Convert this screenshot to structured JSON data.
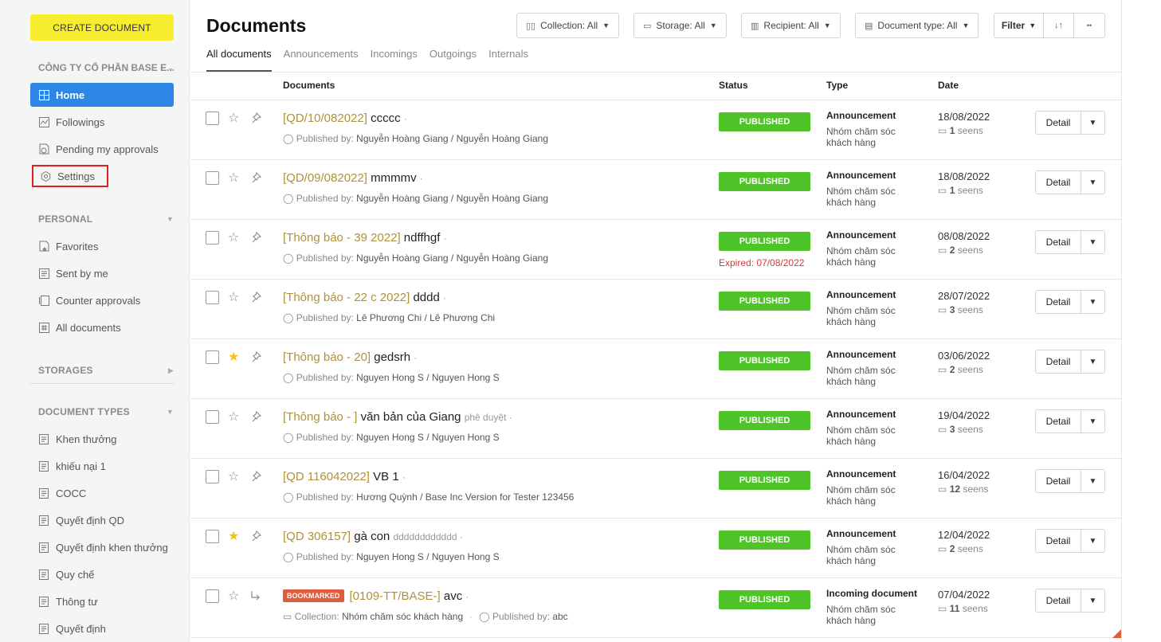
{
  "sidebar": {
    "create_label": "CREATE DOCUMENT",
    "company": "CÔNG TY CỔ PHẦN BASE E...",
    "main_items": [
      {
        "label": "Home",
        "icon": "grid-icon"
      },
      {
        "label": "Followings",
        "icon": "chart-icon"
      },
      {
        "label": "Pending my approvals",
        "icon": "clock-doc-icon"
      },
      {
        "label": "Settings",
        "icon": "gear-icon"
      }
    ],
    "personal_title": "PERSONAL",
    "personal_items": [
      {
        "label": "Favorites",
        "icon": "star-doc-icon"
      },
      {
        "label": "Sent by me",
        "icon": "doc-icon"
      },
      {
        "label": "Counter approvals",
        "icon": "copy-icon"
      },
      {
        "label": "All documents",
        "icon": "hash-icon"
      }
    ],
    "storages_title": "STORAGES",
    "doctypes_title": "DOCUMENT TYPES",
    "doctype_items": [
      "Khen thưởng",
      "khiếu nại 1",
      "COCC",
      "Quyết định QD",
      "Quyết định khen thưởng",
      "Quy chế",
      "Thông tư",
      "Quyết định"
    ]
  },
  "header": {
    "title": "Documents",
    "filters": [
      {
        "label": "Collection: All",
        "icon": "book-icon"
      },
      {
        "label": "Storage: All",
        "icon": "box-icon"
      },
      {
        "label": "Recipient: All",
        "icon": "columns-icon"
      },
      {
        "label": "Document type: All",
        "icon": "file-icon"
      }
    ],
    "filter_label": "Filter",
    "sort_icon": "↓↑",
    "more_icon": "••"
  },
  "tabs": [
    "All documents",
    "Announcements",
    "Incomings",
    "Outgoings",
    "Internals"
  ],
  "columns": {
    "documents": "Documents",
    "status": "Status",
    "type": "Type",
    "date": "Date"
  },
  "rows": [
    {
      "code": "[QD/10/082022]",
      "name": "ccccc",
      "sub": "",
      "meta_label": "Published by:",
      "meta_value": "Nguyễn Hoàng Giang / Nguyễn Hoàng Giang",
      "status": "PUBLISHED",
      "expired": "",
      "type": "Announcement",
      "recipient": "Nhóm chăm sóc khách hàng",
      "date": "18/08/2022",
      "seens_n": "1",
      "seens_label": "seens",
      "starred": false,
      "badge": ""
    },
    {
      "code": "[QD/09/082022]",
      "name": "mmmmv",
      "sub": "",
      "meta_label": "Published by:",
      "meta_value": "Nguyễn Hoàng Giang / Nguyễn Hoàng Giang",
      "status": "PUBLISHED",
      "expired": "",
      "type": "Announcement",
      "recipient": "Nhóm chăm sóc khách hàng",
      "date": "18/08/2022",
      "seens_n": "1",
      "seens_label": "seens",
      "starred": false,
      "badge": ""
    },
    {
      "code": "[Thông báo - 39 2022]",
      "name": "ndffhgf",
      "sub": "",
      "meta_label": "Published by:",
      "meta_value": "Nguyễn Hoàng Giang / Nguyễn Hoàng Giang",
      "status": "PUBLISHED",
      "expired": "Expired: 07/08/2022",
      "type": "Announcement",
      "recipient": "Nhóm chăm sóc khách hàng",
      "date": "08/08/2022",
      "seens_n": "2",
      "seens_label": "seens",
      "starred": false,
      "badge": ""
    },
    {
      "code": "[Thông báo - 22 c 2022]",
      "name": "dddd",
      "sub": "",
      "meta_label": "Published by:",
      "meta_value": "Lê Phương Chi / Lê Phương Chi",
      "status": "PUBLISHED",
      "expired": "",
      "type": "Announcement",
      "recipient": "Nhóm chăm sóc khách hàng",
      "date": "28/07/2022",
      "seens_n": "3",
      "seens_label": "seens",
      "starred": false,
      "badge": ""
    },
    {
      "code": "[Thông báo - 20]",
      "name": "gedsrh",
      "sub": "",
      "meta_label": "Published by:",
      "meta_value": "Nguyen Hong S / Nguyen Hong S",
      "status": "PUBLISHED",
      "expired": "",
      "type": "Announcement",
      "recipient": "Nhóm chăm sóc khách hàng",
      "date": "03/06/2022",
      "seens_n": "2",
      "seens_label": "seens",
      "starred": true,
      "badge": ""
    },
    {
      "code": "[Thông báo - ]",
      "name": "văn bản của Giang",
      "sub": "phê duyệt",
      "meta_label": "Published by:",
      "meta_value": "Nguyen Hong S / Nguyen Hong S",
      "status": "PUBLISHED",
      "expired": "",
      "type": "Announcement",
      "recipient": "Nhóm chăm sóc khách hàng",
      "date": "19/04/2022",
      "seens_n": "3",
      "seens_label": "seens",
      "starred": false,
      "badge": ""
    },
    {
      "code": "[QD 116042022]",
      "name": "VB 1",
      "sub": "",
      "meta_label": "Published by:",
      "meta_value": "Hương Quỳnh / Base Inc Version for Tester 123456",
      "status": "PUBLISHED",
      "expired": "",
      "type": "Announcement",
      "recipient": "Nhóm chăm sóc khách hàng",
      "date": "16/04/2022",
      "seens_n": "12",
      "seens_label": "seens",
      "starred": false,
      "badge": ""
    },
    {
      "code": "[QD 306157]",
      "name": "gà con",
      "sub": "dddddddddddd",
      "meta_label": "Published by:",
      "meta_value": "Nguyen Hong S / Nguyen Hong S",
      "status": "PUBLISHED",
      "expired": "",
      "type": "Announcement",
      "recipient": "Nhóm chăm sóc khách hàng",
      "date": "12/04/2022",
      "seens_n": "2",
      "seens_label": "seens",
      "starred": true,
      "badge": ""
    },
    {
      "code": "[0109-TT/BASE-]",
      "name": "avc",
      "sub": "",
      "meta_label": "Collection:",
      "meta_value": "Nhóm chăm sóc khách hàng",
      "meta2_label": "Published by:",
      "meta2_value": "abc",
      "status": "PUBLISHED",
      "expired": "",
      "type": "Incoming document",
      "recipient": "Nhóm chăm sóc khách hàng",
      "date": "07/04/2022",
      "seens_n": "11",
      "seens_label": "seens",
      "starred": false,
      "badge": "BOOKMARKED"
    }
  ],
  "detail_label": "Detail",
  "colors": {
    "accent": "#2d86e4",
    "published": "#4fc429",
    "code": "#b0913a",
    "create": "#f7ec2e",
    "badge": "#e05a3c",
    "highlight": "#e21d1d"
  }
}
